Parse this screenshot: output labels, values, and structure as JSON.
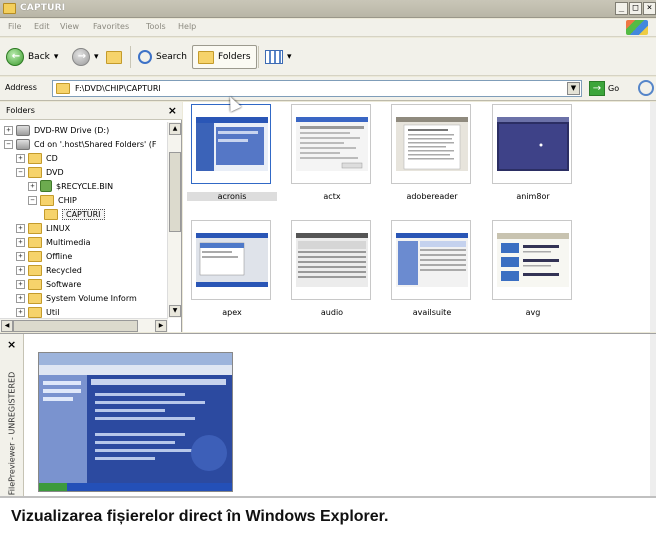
{
  "window": {
    "title": "CAPTURI",
    "controls": [
      "_",
      "□",
      "×"
    ]
  },
  "menu": [
    "File",
    "Edit",
    "View",
    "Favorites",
    "Tools",
    "Help"
  ],
  "toolbar": {
    "back_label": "Back",
    "search_label": "Search",
    "folders_label": "Folders"
  },
  "address": {
    "label": "Address",
    "path": "F:\\DVD\\CHIP\\CAPTURI",
    "go_label": "Go"
  },
  "folders_pane": {
    "title": "Folders",
    "tree": [
      {
        "label": "DVD-RW Drive (D:)",
        "exp": "+",
        "icon": "drive"
      },
      {
        "label": "Cd on '.host\\Shared Folders' (F",
        "exp": "−",
        "icon": "drive"
      },
      {
        "label": "CD",
        "exp": "+",
        "icon": "folder"
      },
      {
        "label": "DVD",
        "exp": "−",
        "icon": "folder"
      },
      {
        "label": "$RECYCLE.BIN",
        "exp": "+",
        "icon": "recycle"
      },
      {
        "label": "CHIP",
        "exp": "−",
        "icon": "folder"
      },
      {
        "label": "CAPTURI",
        "exp": "",
        "icon": "folder",
        "selected": true
      },
      {
        "label": "LINUX",
        "exp": "+",
        "icon": "folder"
      },
      {
        "label": "Multimedia",
        "exp": "+",
        "icon": "folder"
      },
      {
        "label": "Offline",
        "exp": "+",
        "icon": "folder"
      },
      {
        "label": "Recycled",
        "exp": "+",
        "icon": "folder"
      },
      {
        "label": "Software",
        "exp": "+",
        "icon": "folder"
      },
      {
        "label": "System Volume Inform",
        "exp": "+",
        "icon": "folder"
      },
      {
        "label": "Util",
        "exp": "+",
        "icon": "folder"
      }
    ]
  },
  "files": [
    {
      "name": "acronis",
      "selected": true,
      "scheme": "acronis"
    },
    {
      "name": "actx",
      "selected": false,
      "scheme": "dialog"
    },
    {
      "name": "adobereader",
      "selected": false,
      "scheme": "document"
    },
    {
      "name": "anim8or",
      "selected": false,
      "scheme": "dark"
    },
    {
      "name": "apex",
      "selected": false,
      "scheme": "apex"
    },
    {
      "name": "audio",
      "selected": false,
      "scheme": "audio"
    },
    {
      "name": "availsuite",
      "selected": false,
      "scheme": "table"
    },
    {
      "name": "avg",
      "selected": false,
      "scheme": "avg"
    }
  ],
  "preview": {
    "label": "FilePreviewer - UNREGISTERED"
  },
  "caption": "Vizualizarea fișierelor direct în Windows Explorer.",
  "colors": {
    "selection": "#3169c6",
    "xp_blue": "#2c4aa0",
    "toolbar_bg": "#f2f1ea"
  }
}
